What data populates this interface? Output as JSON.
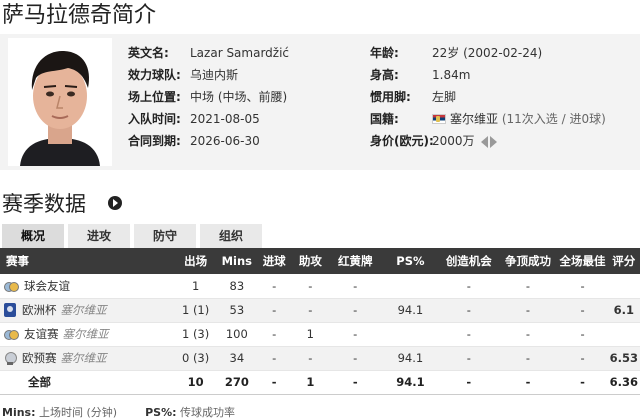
{
  "page_title": "萨马拉德奇简介",
  "profile": {
    "left": [
      {
        "label": "英文名:",
        "value": "Lazar Samardžić"
      },
      {
        "label": "效力球队:",
        "value": "乌迪内斯"
      },
      {
        "label": "场上位置:",
        "value": "中场 (中场、前腰)"
      },
      {
        "label": "入队时间:",
        "value": "2021-08-05"
      },
      {
        "label": "合同到期:",
        "value": "2026-06-30"
      }
    ],
    "age": {
      "label": "年龄:",
      "value": "22岁",
      "birth": "(2002-02-24)"
    },
    "height": {
      "label": "身高:",
      "value": "1.84m"
    },
    "foot": {
      "label": "惯用脚:",
      "value": "左脚"
    },
    "nationality": {
      "label": "国籍:",
      "country": "塞尔维亚",
      "caps": "(11次入选 / 进0球)"
    },
    "value": {
      "label": "身价(欧元):",
      "value": "2000万"
    }
  },
  "section_title": "赛季数据",
  "tabs": [
    "概况",
    "进攻",
    "防守",
    "组织"
  ],
  "table": {
    "headers": [
      "赛事",
      "出场",
      "Mins",
      "进球",
      "助攻",
      "红黄牌",
      "PS%",
      "创造机会",
      "争顶成功",
      "全场最佳",
      "评分"
    ],
    "rows": [
      {
        "icon": "friendly-icon",
        "competition": "球会友谊",
        "team": "",
        "apps": "1",
        "mins": "83",
        "goals": "-",
        "assists": "-",
        "cards": "-",
        "ps": "",
        "chances": "-",
        "aerials": "-",
        "motm": "-",
        "rating": ""
      },
      {
        "icon": "euro-icon",
        "competition": "欧洲杯",
        "team": "塞尔维亚",
        "apps": "1 (1)",
        "mins": "53",
        "goals": "-",
        "assists": "-",
        "cards": "-",
        "ps": "94.1",
        "chances": "-",
        "aerials": "-",
        "motm": "-",
        "rating": "6.1"
      },
      {
        "icon": "friendly-icon",
        "competition": "友谊赛",
        "team": "塞尔维亚",
        "apps": "1 (3)",
        "mins": "100",
        "goals": "-",
        "assists": "1",
        "cards": "-",
        "ps": "",
        "chances": "-",
        "aerials": "-",
        "motm": "-",
        "rating": ""
      },
      {
        "icon": "cup-icon",
        "competition": "欧预赛",
        "team": "塞尔维亚",
        "apps": "0 (3)",
        "mins": "34",
        "goals": "-",
        "assists": "-",
        "cards": "-",
        "ps": "94.1",
        "chances": "-",
        "aerials": "-",
        "motm": "-",
        "rating": "6.53"
      }
    ],
    "total": {
      "label": "全部",
      "apps": "10",
      "mins": "270",
      "goals": "-",
      "assists": "1",
      "cards": "-",
      "ps": "94.1",
      "chances": "-",
      "aerials": "-",
      "motm": "-",
      "rating": "6.36"
    }
  },
  "legend": {
    "mins_key": "Mins:",
    "mins_text": "上场时间 (分钟)",
    "ps_key": "PS%:",
    "ps_text": "传球成功率"
  }
}
